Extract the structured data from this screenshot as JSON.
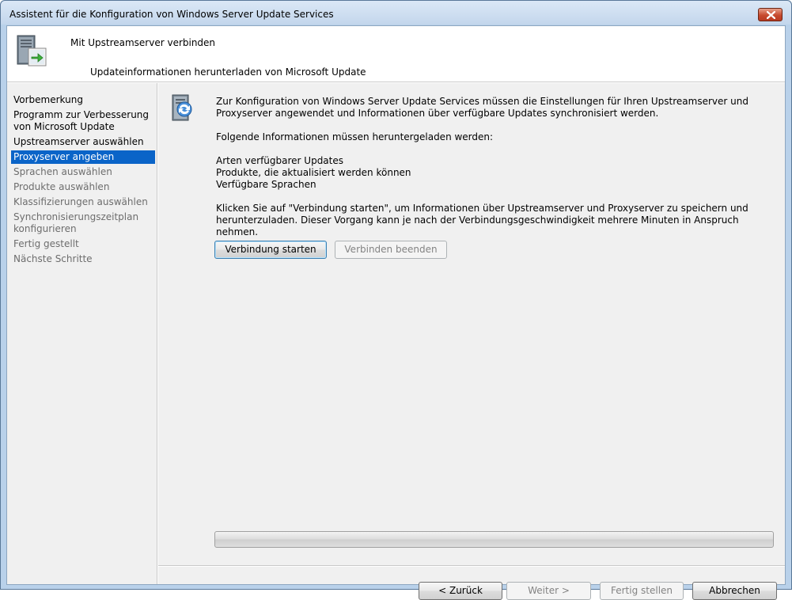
{
  "window": {
    "title": "Assistent für die Konfiguration von Windows Server Update Services"
  },
  "header": {
    "title": "Mit Upstreamserver verbinden",
    "subtitle": "Updateinformationen herunterladen von Microsoft Update"
  },
  "sidebar": {
    "items": [
      {
        "label": "Vorbemerkung",
        "state": "done"
      },
      {
        "label": "Programm zur Verbesserung von Microsoft Update",
        "state": "done"
      },
      {
        "label": "Upstreamserver auswählen",
        "state": "done"
      },
      {
        "label": "Proxyserver angeben",
        "state": "active"
      },
      {
        "label": "Sprachen auswählen",
        "state": "disabled"
      },
      {
        "label": "Produkte auswählen",
        "state": "disabled"
      },
      {
        "label": "Klassifizierungen auswählen",
        "state": "disabled"
      },
      {
        "label": "Synchronisierungszeitplan konfigurieren",
        "state": "disabled"
      },
      {
        "label": "Fertig gestellt",
        "state": "disabled"
      },
      {
        "label": "Nächste Schritte",
        "state": "disabled"
      }
    ]
  },
  "main": {
    "intro": "Zur Konfiguration von Windows Server Update Services müssen die Einstellungen für Ihren Upstreamserver und Proxyserver angewendet und Informationen über verfügbare Updates synchronisiert werden.",
    "download_heading": "Folgende Informationen müssen heruntergeladen werden:",
    "download_items": [
      "Arten verfügbarer Updates",
      "Produkte, die aktualisiert werden können",
      "Verfügbare Sprachen"
    ],
    "instruction": "Klicken Sie auf \"Verbindung starten\", um Informationen über Upstreamserver und Proxyserver zu speichern und herunterzuladen. Dieser Vorgang kann je nach der Verbindungsgeschwindigkeit mehrere Minuten in Anspruch nehmen.",
    "start_button": "Verbindung starten",
    "stop_button": "Verbinden beenden",
    "progress_percent": 0
  },
  "footer": {
    "back_button": "< Zurück",
    "next_button": "Weiter >",
    "finish_button": "Fertig stellen",
    "cancel_button": "Abbrechen"
  },
  "colors": {
    "selection": "#0a64c8",
    "frame": "#b9d1ea",
    "panel": "#f0f0f0"
  }
}
